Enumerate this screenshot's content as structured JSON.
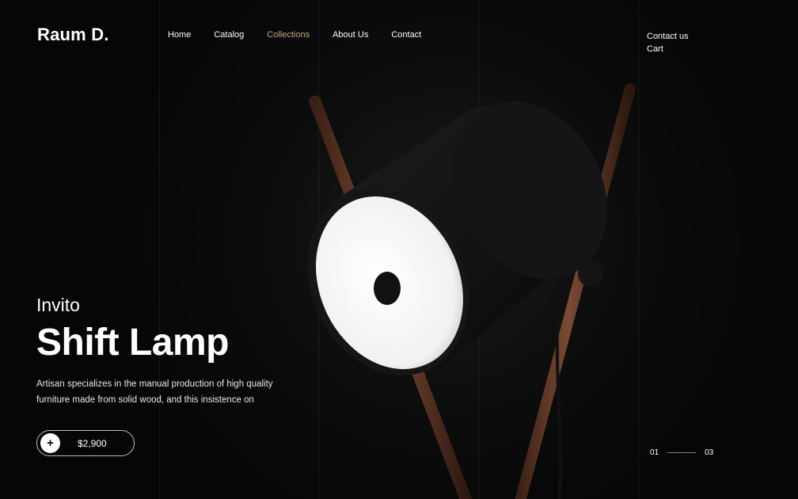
{
  "header": {
    "logo": "Raum D.",
    "nav": [
      {
        "label": "Home",
        "active": false
      },
      {
        "label": "Catalog",
        "active": false
      },
      {
        "label": "Collections",
        "active": true
      },
      {
        "label": "About Us",
        "active": false
      },
      {
        "label": "Contact",
        "active": false
      }
    ],
    "right_links": [
      {
        "label": "Contact us"
      },
      {
        "label": "Cart"
      }
    ]
  },
  "hero": {
    "brand": "Invito",
    "title": "Shift Lamp",
    "description": "Artisan specializes in the manual production of high quality furniture made from solid wood, and this insistence on",
    "price": "$2,900",
    "add_icon": "plus-icon"
  },
  "pager": {
    "current": "01",
    "total": "03"
  },
  "colors": {
    "background": "#080808",
    "accent": "#c9a77a",
    "text": "#ffffff"
  }
}
